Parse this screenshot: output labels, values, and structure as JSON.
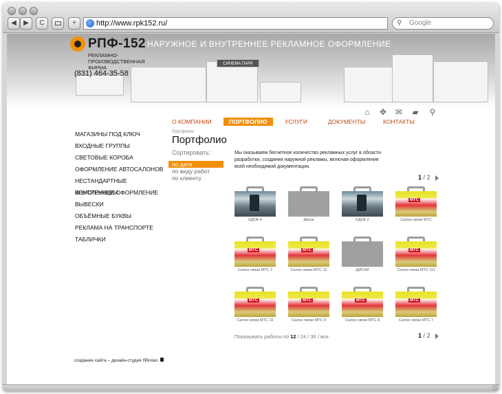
{
  "browser": {
    "back_label": "◀",
    "forward_label": "▶",
    "reload_label": "C",
    "add_label": "+",
    "url": "http://www.rpk152.ru/",
    "search_placeholder": "Google"
  },
  "header": {
    "logo_text": "РПФ-152",
    "logo_sub": "РЕКЛАМНО-ПРОИЗВОДСТВЕННАЯ ФИРМА",
    "phone": "(831) 464-35-58",
    "tagline": "НАРУЖНОЕ И ВНУТРЕННЕЕ РЕКЛАМНОЕ ОФОРМЛЕНИЕ",
    "building_sign": "СИНЕМА ПАРК",
    "icons": [
      "home-icon",
      "sitemap-icon",
      "mail-icon",
      "chat-icon",
      "search-icon"
    ]
  },
  "topnav": [
    {
      "label": "О КОМПАНИИ",
      "active": false
    },
    {
      "label": "ПОРТФОЛИО",
      "active": true
    },
    {
      "label": "УСЛУГИ",
      "active": false
    },
    {
      "label": "ДОКУМЕНТЫ",
      "active": false
    },
    {
      "label": "КОНТАКТЫ",
      "active": false
    }
  ],
  "leftmenu": [
    "МАГАЗИНЫ ПОД КЛЮЧ",
    "ВХОДНЫЕ ГРУППЫ",
    "СВЕТОВЫЕ КОРОБА",
    "ОФОРМЛЕНИЕ АВТОСАЛОНОВ",
    "НЕСТАНДАРТНЫЕ КОНСТРУКЦИИ",
    "ВНУТРЕННЕЕ ОФОРМЛЕНИЕ",
    "ВЫВЕСКИ",
    "ОБЪЁМНЫЕ БУКВЫ",
    "РЕКЛАМА НА ТРАНСПОРТЕ",
    "ТАБЛИЧКИ"
  ],
  "page": {
    "breadcrumb": "Портфолио",
    "title": "Портфолио",
    "sort_label": "Сортировать:",
    "sort_options": [
      {
        "label": "по дате",
        "selected": true
      },
      {
        "label": "по виду работ",
        "selected": false
      },
      {
        "label": "по клиенту",
        "selected": false
      }
    ],
    "intro": "Мы оказываем бесчетное количество рекламных услуг в области разработки, создания наружной рекламы, включая оформление всей необходимой документации."
  },
  "pager": {
    "current": "1",
    "separator": "/",
    "total": "2"
  },
  "portfolio": [
    {
      "caption": "ЕДОК 4",
      "style": "photo"
    },
    {
      "caption": "Диски",
      "style": "blank"
    },
    {
      "caption": "ЕДОК 2",
      "style": "photo"
    },
    {
      "caption": "Салон связи МТС",
      "style": "mts"
    },
    {
      "caption": "Салон связи МТС 2",
      "style": "mts"
    },
    {
      "caption": "Салон связи МТС 12",
      "style": "mts"
    },
    {
      "caption": "ДИСКИ",
      "style": "blank"
    },
    {
      "caption": "Салон связи МТС 111",
      "style": "mts"
    },
    {
      "caption": "Салон связи МТС 10",
      "style": "mts"
    },
    {
      "caption": "Салон связи МТС 9",
      "style": "mts"
    },
    {
      "caption": "Салон связи МТС 8",
      "style": "mts"
    },
    {
      "caption": "Салон связи МТС 7",
      "style": "mts"
    }
  ],
  "show_by": {
    "label": "Показывать работы по",
    "options": [
      "12",
      "24",
      "36",
      "все"
    ],
    "selected": "12",
    "separator": "/"
  },
  "footer": {
    "credit": "создание сайта – дизайн-студия Яблоко"
  },
  "colors": {
    "accent": "#f0900a",
    "nav_text": "#c5470f"
  }
}
